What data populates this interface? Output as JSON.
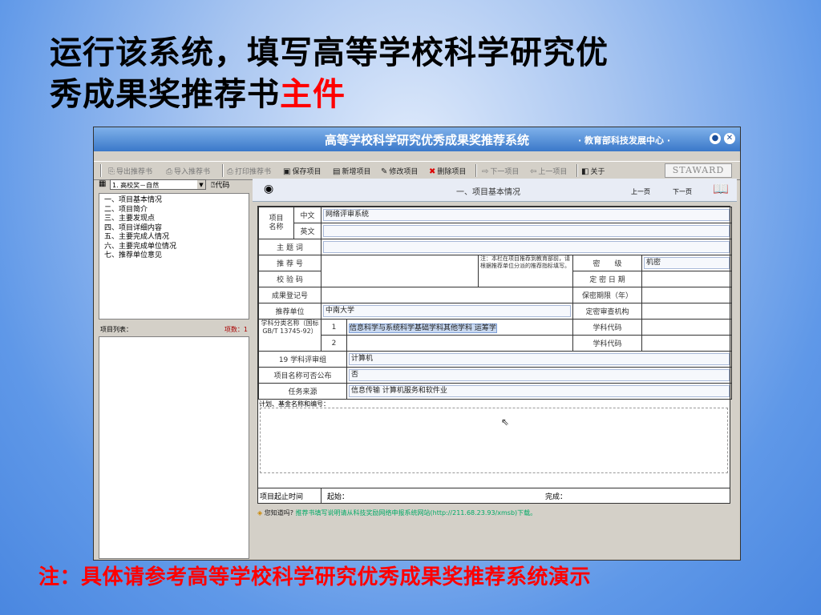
{
  "slide": {
    "title_line1": "运行该系统，填写高等学校科学研究优",
    "title_line2_black": "秀成果奖推荐书",
    "title_line2_red": "主件",
    "footnote": "注：具体请参考高等学校科学研究优秀成果奖推荐系统演示"
  },
  "window": {
    "title": "高等学校科学研究优秀成果奖推荐系统",
    "subtitle": "· 教育部科技发展中心 ·",
    "minimize": "●",
    "close": "✕"
  },
  "toolbar": {
    "export": "导出推荐书",
    "import": "导入推荐书",
    "print": "打印推荐书",
    "save": "保存项目",
    "new": "新增项目",
    "edit": "修改项目",
    "delete": "删除项目",
    "next": "下一项目",
    "prev": "上一项目",
    "about": "关于",
    "logo": "STAWARD"
  },
  "left_panel": {
    "selector_value": "1. 高校奖－自然",
    "code_button": "代码",
    "tree_items": [
      "一、项目基本情况",
      "二、项目简介",
      "三、主要发现点",
      "四、项目详细内容",
      "五、主要完成人情况",
      "六、主要完成单位情况",
      "七、推荐单位意见"
    ],
    "list_label": "项目列表：",
    "list_count": "项数：1"
  },
  "form": {
    "section_title": "一、项目基本情况",
    "prev_page": "上一页",
    "next_page": "下一页",
    "project_name_label": "项目\n名称",
    "chinese_label": "中文",
    "chinese_value": "网络评审系统",
    "english_label": "英文",
    "english_value": "",
    "keywords_label": "主 题 词",
    "recommend_no_label": "推 荐 号",
    "note_text": "注：本栏在项目推荐到教育部前，请根据推荐单位分派的推荐指标填写。",
    "secret_level_label": "密　　级",
    "secret_level_value": "机密",
    "check_code_label": "校 验 码",
    "secret_date_label": "定 密 日 期",
    "registration_label": "成果登记号",
    "secret_period_label": "保密期限（年）",
    "recommend_unit_label": "推荐单位",
    "recommend_unit_value": "中南大学",
    "secret_review_label": "定密审查机构",
    "subject_class_label": "学科分类名称（国标GB/T 13745-92）",
    "subject_row1_no": "1",
    "subject_row1_value": "信息科学与系统科学基础学科其他学科 运筹学",
    "subject_row2_no": "2",
    "subject_code_label": "学科代码",
    "review_group_label": "19 学科评审组",
    "review_group_value": "计算机",
    "publishable_label": "项目名称可否公布",
    "publishable_value": "否",
    "task_source_label": "任务来源",
    "task_source_value": "信息传输 计算机服务和软件业",
    "plan_label": "计划、基金名称和编号：",
    "time_label": "项目起止时间",
    "start_label": "起始：",
    "end_label": "完成："
  },
  "tip": {
    "question": "您知道吗?",
    "text": "推荐书填写说明请从科技奖励网络申报系统网站(http://211.68.23.93/xmsb)下载。"
  }
}
